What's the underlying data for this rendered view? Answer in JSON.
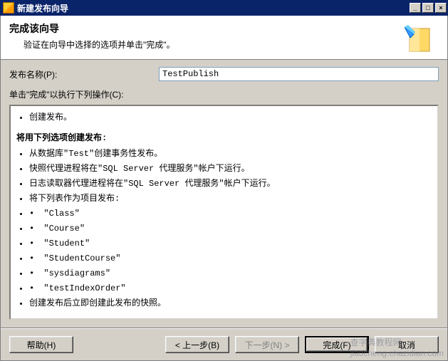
{
  "window": {
    "title": "新建发布向导",
    "minimize": "_",
    "maximize": "□",
    "close": "×"
  },
  "header": {
    "title": "完成该向导",
    "subtitle": "验证在向导中选择的选项并单击\"完成\"。"
  },
  "form": {
    "name_label": "发布名称(P):",
    "name_value": "TestPublish",
    "instruction": "单击\"完成\"以执行下列操作(C):"
  },
  "actions": {
    "create": "创建发布。"
  },
  "summary": {
    "heading": "将用下列选项创建发布:",
    "items": [
      "从数据库\"Test\"创建事务性发布。",
      "快照代理进程将在\"SQL Server 代理服务\"帐户下运行。",
      "日志读取器代理进程将在\"SQL Server 代理服务\"帐户下运行。",
      "将下列表作为项目发布:"
    ],
    "tables": [
      "\"Class\"",
      "\"Course\"",
      "\"Student\"",
      "\"StudentCourse\"",
      "\"sysdiagrams\"",
      "\"testIndexOrder\""
    ],
    "after_tables": "创建发布后立即创建此发布的快照。"
  },
  "buttons": {
    "help": "帮助(H)",
    "back": "< 上一步(B)",
    "next": "下一步(N) >",
    "finish": "完成(F)",
    "cancel": "取消"
  },
  "watermark": {
    "cn": "查字典教程网",
    "url": "jiaocheng.chazidian.com"
  }
}
